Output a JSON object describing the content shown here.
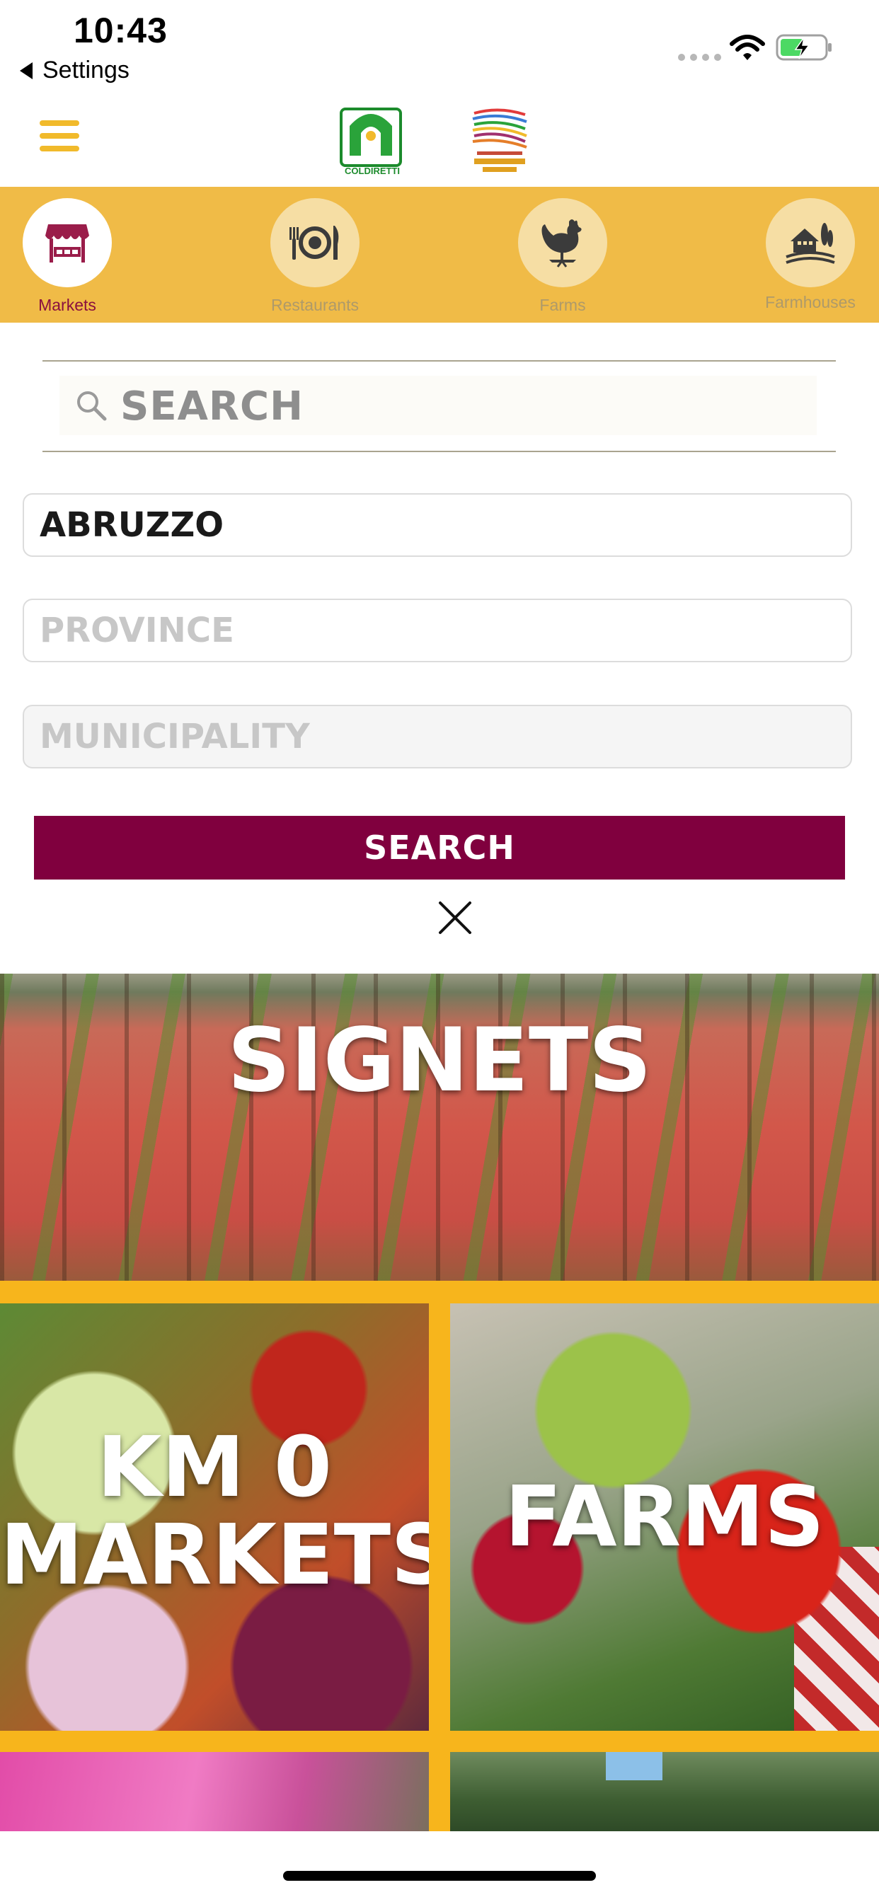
{
  "status_bar": {
    "time": "10:43",
    "back_label": "Settings",
    "battery": "charging"
  },
  "header": {
    "menu_icon": "hamburger-icon",
    "logos": [
      "COLDIRETTI"
    ]
  },
  "categories": [
    {
      "label": "Markets",
      "icon": "market-stall-icon",
      "active": true
    },
    {
      "label": "Restaurants",
      "icon": "plate-cutlery-icon",
      "active": false
    },
    {
      "label": "Farms",
      "icon": "rooster-icon",
      "active": false
    },
    {
      "label": "Farmhouses",
      "icon": "farmhouse-icon",
      "active": false
    }
  ],
  "search": {
    "placeholder": "SEARCH"
  },
  "filters": {
    "region": "ABRUZZO",
    "province_placeholder": "PROVINCE",
    "municipality_placeholder": "MUNICIPALITY"
  },
  "actions": {
    "search_button": "SEARCH"
  },
  "tiles": {
    "signets": "SIGNETS",
    "markets_line1": "KM 0",
    "markets_line2": "MARKETS",
    "farms": "FARMS"
  },
  "colors": {
    "accent_yellow": "#f0bb47",
    "brand_burgundy": "#80003e",
    "tile_grid_yellow": "#f7b51c"
  }
}
